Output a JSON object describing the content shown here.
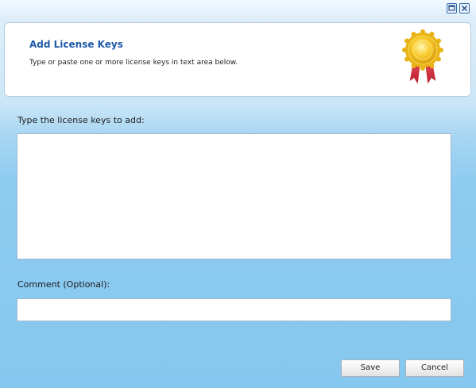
{
  "window": {
    "maximize_icon": "maximize-icon",
    "close_icon": "close-icon"
  },
  "header": {
    "title": "Add License Keys",
    "subtitle": "Type or paste one or more license keys in text area below.",
    "badge_icon": "award-ribbon-icon"
  },
  "form": {
    "keys_label": "Type the license keys to add:",
    "keys_value": "",
    "comment_label": "Comment (Optional):",
    "comment_value": ""
  },
  "buttons": {
    "save_label": "Save",
    "cancel_label": "Cancel"
  },
  "colors": {
    "title_blue": "#1e5aa8",
    "background_blue": "#86c7ef",
    "medal_gold": "#f5c518",
    "ribbon_red": "#d9333f"
  }
}
